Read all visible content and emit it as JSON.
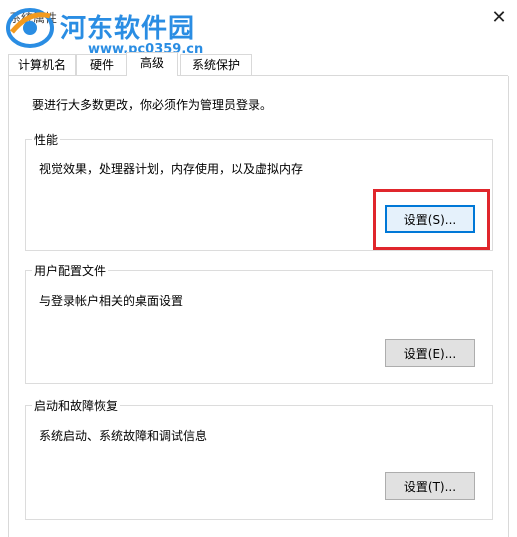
{
  "window": {
    "title": "系统属性",
    "close_glyph": "✕"
  },
  "watermark": {
    "site_name": "河东软件园",
    "site_url": "www.pc0359.cn"
  },
  "tabs": [
    {
      "label": "计算机名",
      "selected": false
    },
    {
      "label": "硬件",
      "selected": false
    },
    {
      "label": "高级",
      "selected": true
    },
    {
      "label": "系统保护",
      "selected": false
    }
  ],
  "advanced": {
    "intro": "要进行大多数更改，你必须作为管理员登录。",
    "performance": {
      "title": "性能",
      "description": "视觉效果，处理器计划，内存使用，以及虚拟内存",
      "button": "设置(S)..."
    },
    "user_profiles": {
      "title": "用户配置文件",
      "description": "与登录帐户相关的桌面设置",
      "button": "设置(E)..."
    },
    "startup_recovery": {
      "title": "启动和故障恢复",
      "description": "系统启动、系统故障和调试信息",
      "button": "设置(T)..."
    }
  },
  "colors": {
    "highlight": "#e0262c",
    "watermark": "#2a8de3",
    "focus": "#0078d7"
  }
}
